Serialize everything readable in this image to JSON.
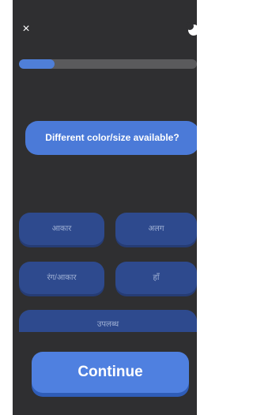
{
  "header": {
    "close_icon": "close-icon",
    "theme_icon": "moon-icon",
    "close_glyph": "×"
  },
  "progress": {
    "value": 0.2
  },
  "question": {
    "text": "Different color/size available?"
  },
  "options": [
    {
      "label": "आकार"
    },
    {
      "label": "अलग"
    },
    {
      "label": "रंग/आकार"
    },
    {
      "label": "हाँ"
    },
    {
      "label": "उपलब्ध"
    }
  ],
  "footer": {
    "continue_label": "Continue"
  },
  "colors": {
    "background": "#2f2f31",
    "accent": "#4f80e0",
    "option": "#2e4a8e"
  }
}
